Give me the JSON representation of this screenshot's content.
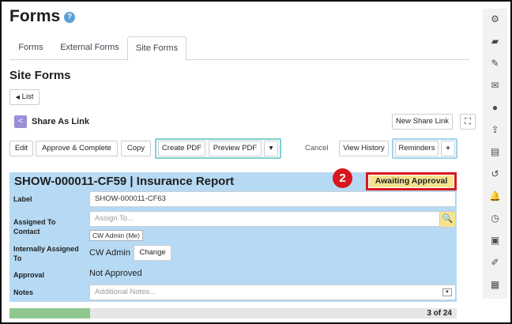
{
  "header": {
    "title": "Forms",
    "help_icon": "?"
  },
  "tabs": [
    {
      "label": "Forms"
    },
    {
      "label": "External Forms"
    },
    {
      "label": "Site Forms",
      "active": true
    }
  ],
  "section": {
    "title": "Site Forms",
    "list_button": "List"
  },
  "share": {
    "label": "Share As Link",
    "new_link_button": "New Share Link"
  },
  "toolbar": {
    "edit": "Edit",
    "approve_complete": "Approve & Complete",
    "copy": "Copy",
    "create_pdf": "Create PDF",
    "preview_pdf": "Preview PDF",
    "more": "▾",
    "cancel": "Cancel",
    "view_history": "View History",
    "reminders": "Reminders",
    "add": "+"
  },
  "form": {
    "title": "SHOW-000011-CF59 | Insurance Report",
    "status": "Awaiting Approval",
    "step_number": "2",
    "fields": {
      "label_label": "Label",
      "label_value": "SHOW-000011-CF63",
      "assigned_contact_label_1": "Assigned To",
      "assigned_contact_label_2": "Contact",
      "assigned_placeholder": "Assign To...",
      "assigned_chip": "CW Admin (Me)",
      "internally_label_1": "Internally Assigned",
      "internally_label_2": "To",
      "internally_value": "CW Admin",
      "change_button": "Change",
      "approval_label": "Approval",
      "approval_value": "Not Approved",
      "notes_label": "Notes",
      "notes_placeholder": "Additional Notes..."
    }
  },
  "progress": {
    "text": "3 of 24",
    "fraction": 0.18
  },
  "colors": {
    "panel": "#b6daf4",
    "status_bg": "#f6e38e",
    "highlight_red": "#d8171f",
    "progress_fill": "#8fc78f",
    "teal_outline": "#7fd0d0"
  },
  "rightbar_icons": [
    {
      "name": "gear-icon",
      "glyph": "⚙"
    },
    {
      "name": "note-icon",
      "glyph": "▰"
    },
    {
      "name": "edit-icon",
      "glyph": "✎"
    },
    {
      "name": "mail-icon",
      "glyph": "✉"
    },
    {
      "name": "sms-icon",
      "glyph": "●"
    },
    {
      "name": "upload-icon",
      "glyph": "⇪"
    },
    {
      "name": "contact-card-icon",
      "glyph": "▤"
    },
    {
      "name": "history-icon",
      "glyph": "↺"
    },
    {
      "name": "bell-icon",
      "glyph": "🔔"
    },
    {
      "name": "clock-icon",
      "glyph": "◷"
    },
    {
      "name": "image-icon",
      "glyph": "▣"
    },
    {
      "name": "brush-icon",
      "glyph": "✐"
    },
    {
      "name": "calculator-icon",
      "glyph": "▦"
    }
  ]
}
